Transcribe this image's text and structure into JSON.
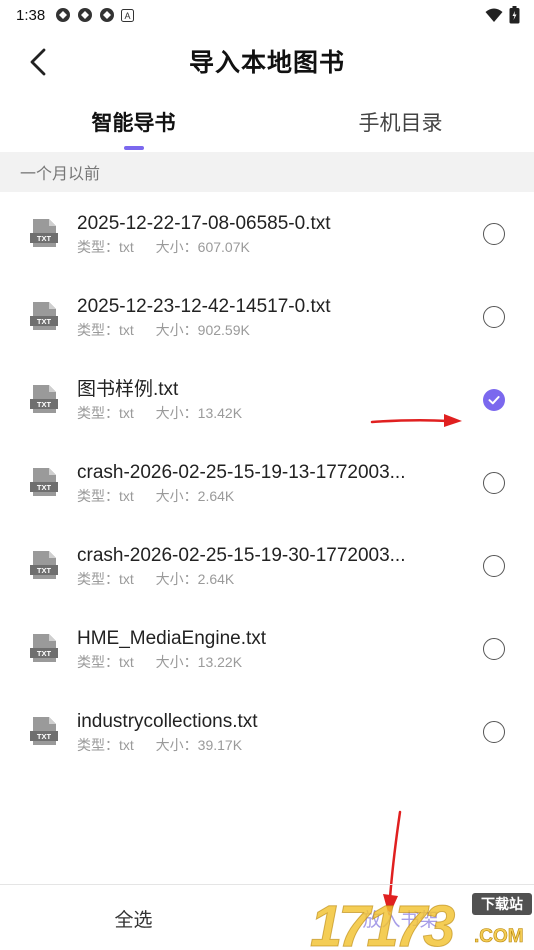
{
  "status": {
    "time": "1:38"
  },
  "header": {
    "title": "导入本地图书"
  },
  "tabs": [
    {
      "label": "智能导书",
      "active": true
    },
    {
      "label": "手机目录",
      "active": false
    }
  ],
  "section": {
    "label": "一个月以前"
  },
  "files": [
    {
      "name": "2025-12-22-17-08-06585-0.txt",
      "type": "类型：txt",
      "size": "大小：607.07K",
      "checked": false
    },
    {
      "name": "2025-12-23-12-42-14517-0.txt",
      "type": "类型：txt",
      "size": "大小：902.59K",
      "checked": false
    },
    {
      "name": "图书样例.txt",
      "type": "类型：txt",
      "size": "大小：13.42K",
      "checked": true
    },
    {
      "name": "crash-2026-02-25-15-19-13-1772003...",
      "type": "类型：txt",
      "size": "大小：2.64K",
      "checked": false
    },
    {
      "name": "crash-2026-02-25-15-19-30-1772003...",
      "type": "类型：txt",
      "size": "大小：2.64K",
      "checked": false
    },
    {
      "name": "HME_MediaEngine.txt",
      "type": "类型：txt",
      "size": "大小：13.22K",
      "checked": false
    },
    {
      "name": "industrycollections.txt",
      "type": "类型：txt",
      "size": "大小：39.17K",
      "checked": false
    }
  ],
  "file_icon_label": "TXT",
  "bottom": {
    "select_all": "全选",
    "add_to_shelf": "放入书架"
  },
  "watermark": {
    "number": "17173",
    "badge": "下载站",
    "domain": ".COM"
  },
  "colors": {
    "accent": "#7b68ee",
    "annotation_arrow": "#e02020",
    "section_bg": "#f2f2f2"
  }
}
